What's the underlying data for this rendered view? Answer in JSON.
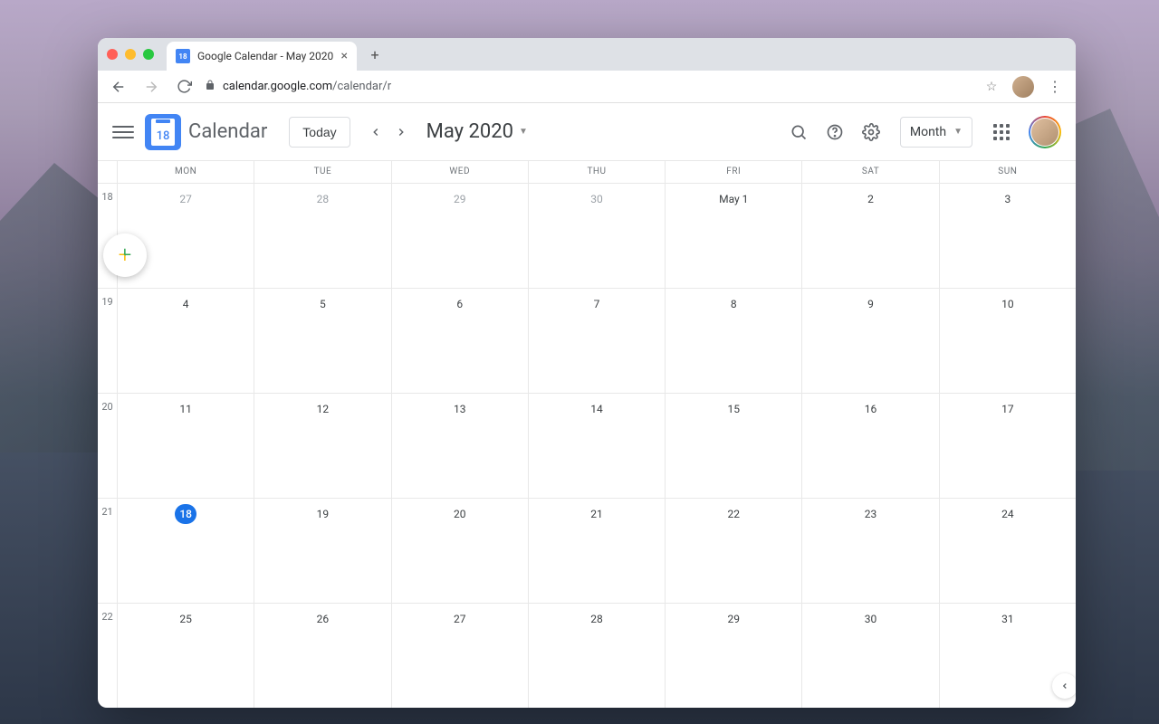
{
  "browser": {
    "tab_title": "Google Calendar - May 2020",
    "url_domain": "calendar.google.com",
    "url_path": "/calendar/r"
  },
  "header": {
    "app_title": "Calendar",
    "logo_date": "18",
    "today_label": "Today",
    "current_label": "May 2020",
    "view_label": "Month"
  },
  "calendar": {
    "day_headers": [
      "MON",
      "TUE",
      "WED",
      "THU",
      "FRI",
      "SAT",
      "SUN"
    ],
    "week_numbers": [
      "18",
      "19",
      "20",
      "21",
      "22"
    ],
    "weeks": [
      [
        {
          "label": "27",
          "other": true
        },
        {
          "label": "28",
          "other": true
        },
        {
          "label": "29",
          "other": true
        },
        {
          "label": "30",
          "other": true
        },
        {
          "label": "May 1"
        },
        {
          "label": "2"
        },
        {
          "label": "3"
        }
      ],
      [
        {
          "label": "4"
        },
        {
          "label": "5"
        },
        {
          "label": "6"
        },
        {
          "label": "7"
        },
        {
          "label": "8"
        },
        {
          "label": "9"
        },
        {
          "label": "10"
        }
      ],
      [
        {
          "label": "11"
        },
        {
          "label": "12"
        },
        {
          "label": "13"
        },
        {
          "label": "14"
        },
        {
          "label": "15"
        },
        {
          "label": "16"
        },
        {
          "label": "17"
        }
      ],
      [
        {
          "label": "18",
          "today": true
        },
        {
          "label": "19"
        },
        {
          "label": "20"
        },
        {
          "label": "21"
        },
        {
          "label": "22"
        },
        {
          "label": "23"
        },
        {
          "label": "24"
        }
      ],
      [
        {
          "label": "25"
        },
        {
          "label": "26"
        },
        {
          "label": "27"
        },
        {
          "label": "28"
        },
        {
          "label": "29"
        },
        {
          "label": "30"
        },
        {
          "label": "31"
        }
      ]
    ]
  }
}
